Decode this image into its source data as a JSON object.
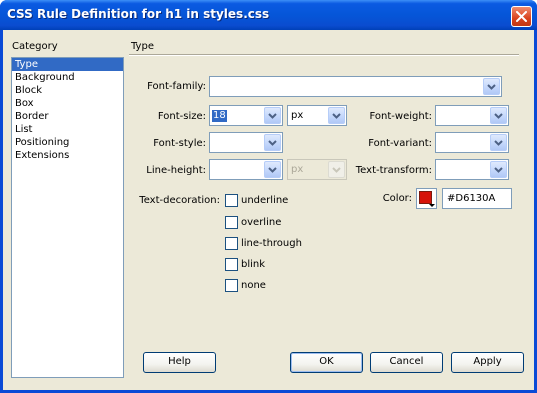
{
  "window": {
    "title": "CSS Rule Definition for h1 in styles.css"
  },
  "category": {
    "label": "Category",
    "items": [
      "Type",
      "Background",
      "Block",
      "Box",
      "Border",
      "List",
      "Positioning",
      "Extensions"
    ],
    "selected": "Type"
  },
  "panel": {
    "heading": "Type"
  },
  "fields": {
    "font_family": {
      "label": "Font-family:",
      "value": ""
    },
    "font_size": {
      "label": "Font-size:",
      "value": "18",
      "unit": "px"
    },
    "font_weight": {
      "label": "Font-weight:",
      "value": ""
    },
    "font_style": {
      "label": "Font-style:",
      "value": ""
    },
    "font_variant": {
      "label": "Font-variant:",
      "value": ""
    },
    "line_height": {
      "label": "Line-height:",
      "value": "",
      "unit": "px"
    },
    "text_transform": {
      "label": "Text-transform:",
      "value": ""
    },
    "color": {
      "label": "Color:",
      "value": "#D6130A",
      "swatch": "#D6130A"
    }
  },
  "text_decoration": {
    "label": "Text-decoration:",
    "options": [
      "underline",
      "overline",
      "line-through",
      "blink",
      "none"
    ]
  },
  "buttons": {
    "help": "Help",
    "ok": "OK",
    "cancel": "Cancel",
    "apply": "Apply"
  },
  "icons": {
    "close": "close-icon",
    "dropdown": "chevron-down-icon"
  },
  "colors": {
    "titlebar": "#0556d8",
    "dialog_bg": "#ece9d8",
    "selection": "#316ac5",
    "close_button": "#d9431e"
  }
}
